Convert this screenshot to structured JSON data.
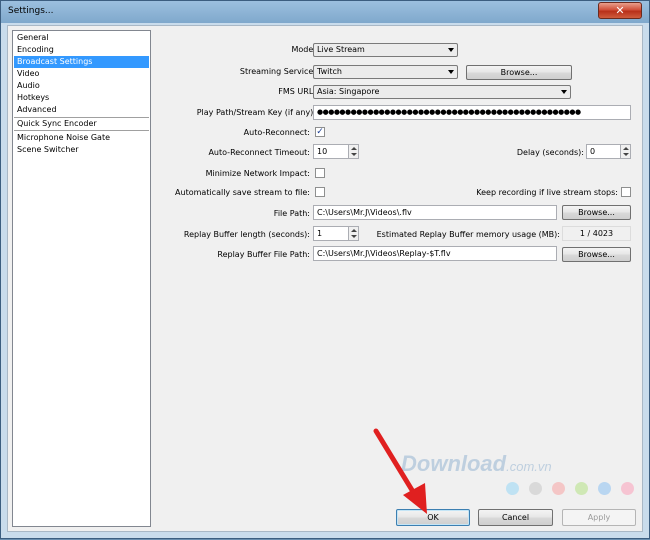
{
  "window": {
    "title": "Settings..."
  },
  "sidebar": {
    "items": [
      {
        "label": "General"
      },
      {
        "label": "Encoding"
      },
      {
        "label": "Broadcast Settings"
      },
      {
        "label": "Video"
      },
      {
        "label": "Audio"
      },
      {
        "label": "Hotkeys"
      },
      {
        "label": "Advanced"
      },
      {
        "label": "Quick Sync Encoder"
      },
      {
        "label": "Microphone Noise Gate"
      },
      {
        "label": "Scene Switcher"
      }
    ]
  },
  "form": {
    "mode_label": "Mode:",
    "mode_value": "Live Stream",
    "service_label": "Streaming Service:",
    "service_value": "Twitch",
    "browse_label": "Browse...",
    "fms_label": "FMS URL:",
    "fms_value": "Asia: Singapore",
    "key_label": "Play Path/Stream Key (if any):",
    "key_value": "●●●●●●●●●●●●●●●●●●●●●●●●●●●●●●●●●●●●●●●●●●●●●●●",
    "autoreconnect_label": "Auto-Reconnect:",
    "autoreconnect_checked": true,
    "timeout_label": "Auto-Reconnect Timeout:",
    "timeout_value": "10",
    "delay_label": "Delay (seconds):",
    "delay_value": "0",
    "minimize_label": "Minimize Network Impact:",
    "autosave_label": "Automatically save stream to file:",
    "keeprec_label": "Keep recording if live stream stops:",
    "filepath_label": "File Path:",
    "filepath_value": "C:\\Users\\Mr.J\\Videos\\.flv",
    "replay_len_label": "Replay Buffer length (seconds):",
    "replay_len_value": "1",
    "replay_mem_label": "Estimated Replay Buffer memory usage (MB):",
    "replay_mem_value": "1 / 4023",
    "replay_path_label": "Replay Buffer File Path:",
    "replay_path_value": "C:\\Users\\Mr.J\\Videos\\Replay-$T.flv"
  },
  "footer": {
    "ok": "OK",
    "cancel": "Cancel",
    "apply": "Apply"
  },
  "watermark": {
    "brand": "Download",
    "domain": ".com.vn"
  },
  "colors": {
    "selection": "#3399ff",
    "arrow": "#e02020"
  }
}
